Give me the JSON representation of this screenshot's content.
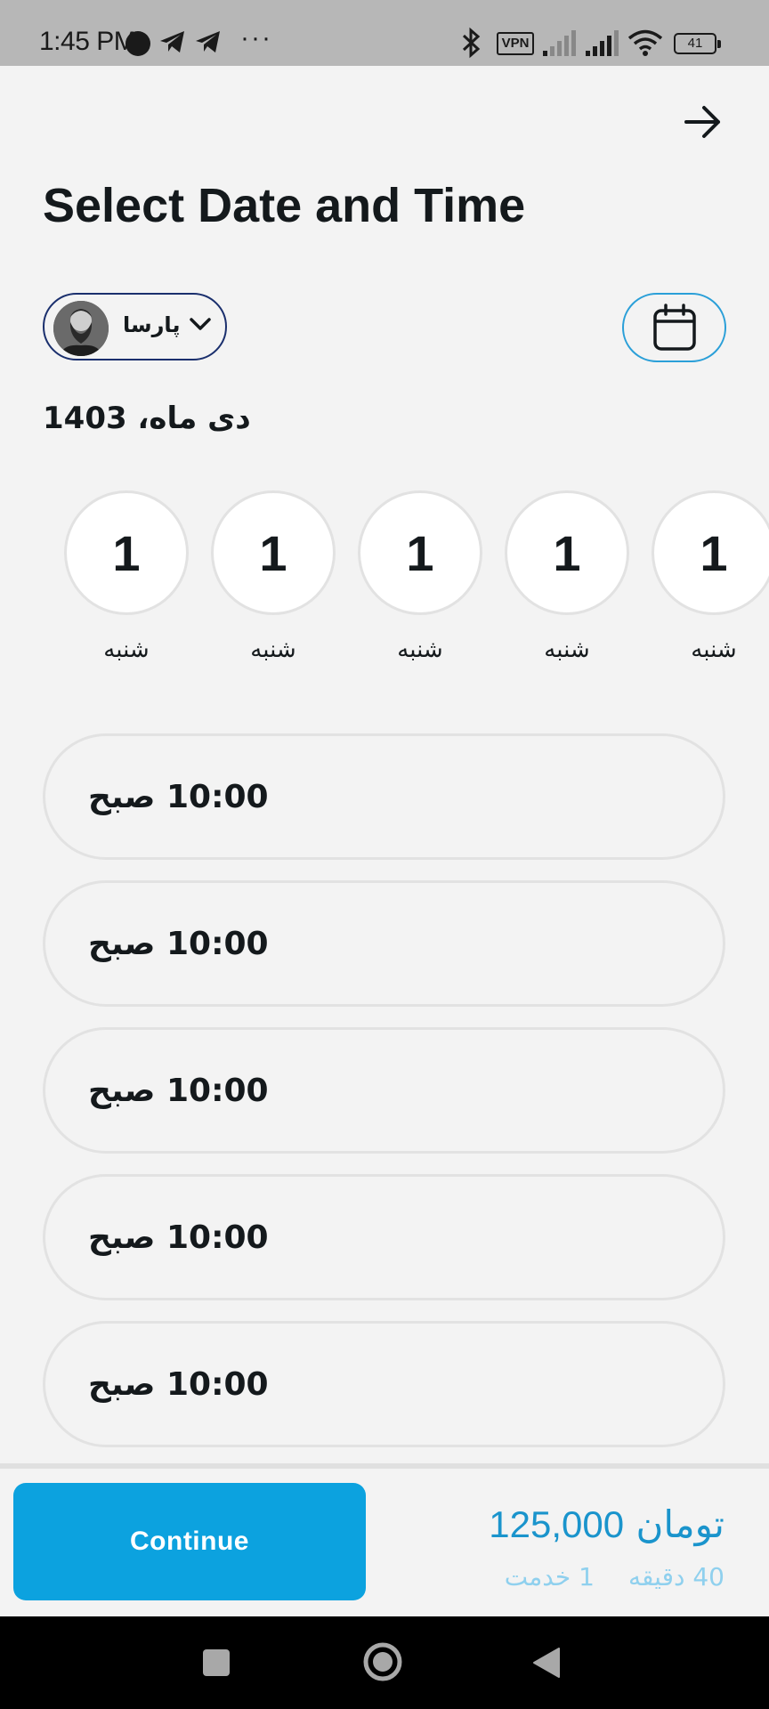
{
  "status_bar": {
    "time": "1:45 PM",
    "vpn_label": "VPN",
    "battery_level": "41"
  },
  "header": {
    "back_icon": "arrow-right-icon",
    "title": "Select Date and Time"
  },
  "staff": {
    "name": "پارسا",
    "dropdown_icon": "chevron-down-icon"
  },
  "calendar_button": {
    "icon": "calendar-icon"
  },
  "month_label": "دی ماه، 1403",
  "days": [
    {
      "number": "1",
      "weekday": "شنبه"
    },
    {
      "number": "1",
      "weekday": "شنبه"
    },
    {
      "number": "1",
      "weekday": "شنبه"
    },
    {
      "number": "1",
      "weekday": "شنبه"
    },
    {
      "number": "1",
      "weekday": "شنبه"
    }
  ],
  "time_slots": [
    {
      "label": "10:00 صبح"
    },
    {
      "label": "10:00 صبح"
    },
    {
      "label": "10:00 صبح"
    },
    {
      "label": "10:00 صبح"
    },
    {
      "label": "10:00 صبح"
    }
  ],
  "footer": {
    "continue_label": "Continue",
    "price_amount": "125,000",
    "price_currency": "تومان",
    "duration": "40 دقیقه",
    "service_count": "1 خدمت"
  },
  "colors": {
    "accent": "#0ca2df",
    "price_text": "#1a94cc",
    "meta_text": "#8fd0ee",
    "staff_border": "#1a2f6d",
    "calendar_border": "#2a9fd8"
  }
}
